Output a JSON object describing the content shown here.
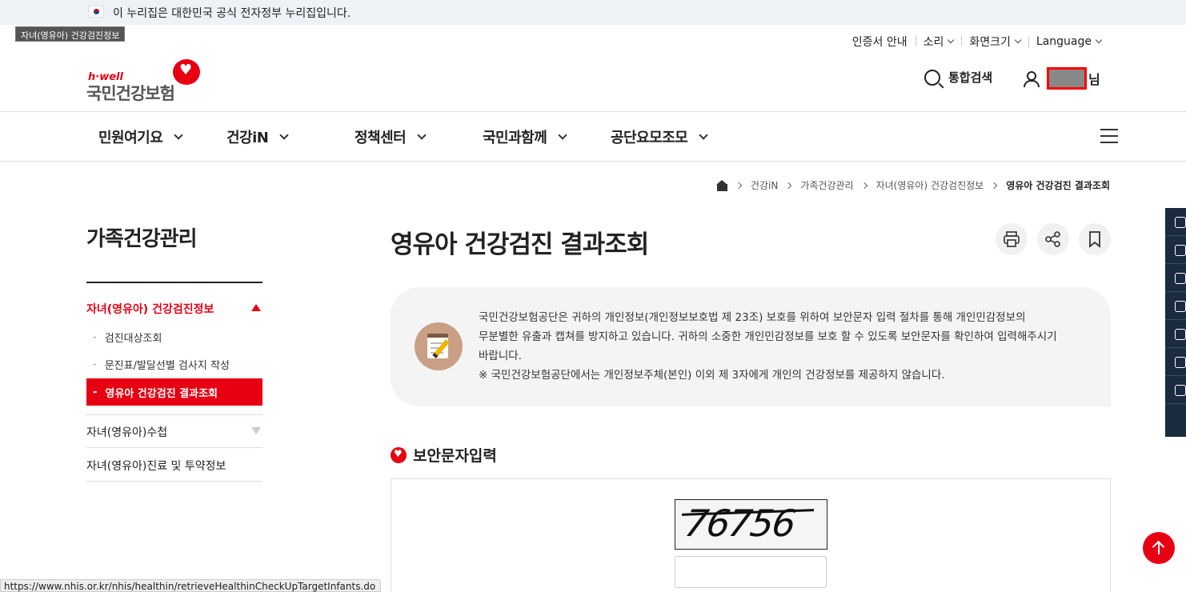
{
  "gov_banner": {
    "text": "이 누리집은 대한민국 공식 전자정부 누리집입니다."
  },
  "tooltip": "자녀(영유아) 건강검진정보",
  "utility": {
    "cert": "인증서 안내",
    "sound": "소리",
    "zoom": "화면크기",
    "language": "Language"
  },
  "logo": {
    "small": "h·well",
    "main": "국민건강보험"
  },
  "header": {
    "search_label": "통합검색",
    "user_suffix": "님"
  },
  "gnb": [
    "민원여기요",
    "건강iN",
    "정책센터",
    "국민과함께",
    "공단요모조모"
  ],
  "breadcrumb": [
    "건강iN",
    "가족건강관리",
    "자녀(영유아) 건강검진정보",
    "영유아 건강검진 결과조회"
  ],
  "sidebar": {
    "title": "가족건강관리",
    "group1": "자녀(영유아) 건강검진정보",
    "sub_items": [
      "검진대상조회",
      "문진표/발달선별 검사지 작성",
      "영유아 건강검진 결과조회"
    ],
    "item2": "자녀(영유아)수첩",
    "item3": "자녀(영유아)진료 및 투약정보"
  },
  "main": {
    "title": "영유아 건강검진 결과조회",
    "notice_line1": "국민건강보험공단은 귀하의 개인정보(개인정보보호법 제 23조) 보호를 위하여 보안문자 입력 절차를 통해 개인민감정보의",
    "notice_line2": "무분별한 유출과 캡쳐를 방지하고 있습니다. 귀하의 소중한 개인민감정보를 보호 할 수 있도록 보안문자를 확인하여 입력해주시기",
    "notice_line3": "바랍니다.",
    "notice_line4": "※ 국민건강보험공단에서는 개인정보주체(본인) 이외 제 3자에게 개인의 건강정보를 제공하지 않습니다.",
    "section_title": "보안문자입력",
    "captcha_text": "76756",
    "captcha_input_value": ""
  },
  "status_url": "https://www.nhis.or.kr/nhis/healthin/retrieveHealthinCheckUpTargetInfants.do",
  "colors": {
    "brand_red": "#e60012",
    "quick_menu": "#1a2a3f"
  }
}
